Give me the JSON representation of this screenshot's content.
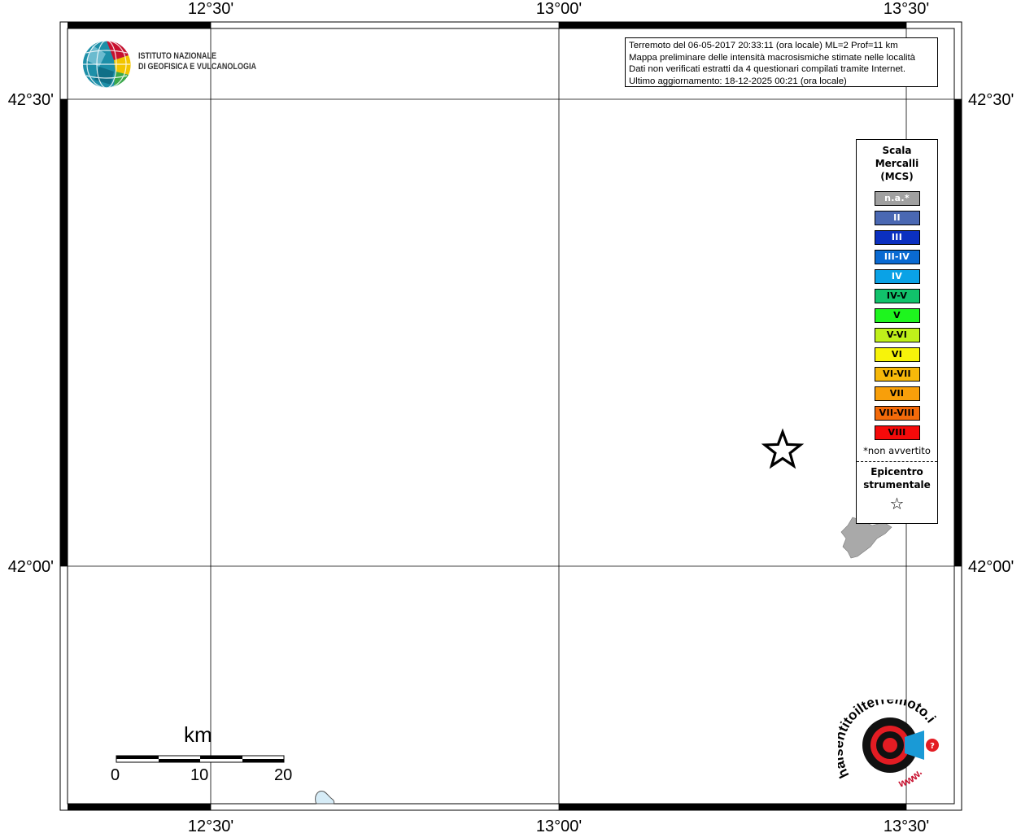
{
  "map": {
    "top_ticks": [
      "12°30'",
      "13°00'",
      "13°30'"
    ],
    "bottom_ticks": [
      "12°30'",
      "13°00'",
      "13°30'"
    ],
    "left_ticks": [
      "42°30'",
      "42°00'"
    ],
    "right_ticks": [
      "42°30'",
      "42°00'"
    ]
  },
  "logo": {
    "line1": "ISTITUTO NAZIONALE",
    "line2": "DI GEOFISICA E VULCANOLOGIA"
  },
  "info": {
    "line1": "Terremoto del 06-05-2017 20:33:11 (ora locale) ML=2 Prof=11 km",
    "line2": "Mappa preliminare delle intensità macrosismiche stimate nelle località",
    "line3": "Dati non verificati estratti da 4 questionari compilati tramite Internet.",
    "line4": "Ultimo aggiornamento: 18-12-2025 00:21 (ora locale)"
  },
  "legend": {
    "title1": "Scala",
    "title2": "Mercalli",
    "title3": "(MCS)",
    "items": [
      {
        "label": "n.a.*",
        "color": "#a0a0a0",
        "light": true
      },
      {
        "label": "II",
        "color": "#4a68b3",
        "light": true
      },
      {
        "label": "III",
        "color": "#0b30c0",
        "light": true
      },
      {
        "label": "III-IV",
        "color": "#0a6ad2",
        "light": true
      },
      {
        "label": "IV",
        "color": "#0aa2e6",
        "light": true
      },
      {
        "label": "IV-V",
        "color": "#11c26b",
        "light": false
      },
      {
        "label": "V",
        "color": "#1ef51e",
        "light": false
      },
      {
        "label": "V-VI",
        "color": "#bff01a",
        "light": false
      },
      {
        "label": "VI",
        "color": "#f7f30a",
        "light": false
      },
      {
        "label": "VI-VII",
        "color": "#f6b80a",
        "light": false
      },
      {
        "label": "VII",
        "color": "#f89f0a",
        "light": false
      },
      {
        "label": "VII-VIII",
        "color": "#f36a0a",
        "light": false
      },
      {
        "label": "VIII",
        "color": "#f50a0a",
        "light": false
      }
    ],
    "note": "*non avvertito",
    "epi1": "Epicentro",
    "epi2": "strumentale",
    "epi_symbol": "☆"
  },
  "scalebar": {
    "unit": "km",
    "labels": [
      "0",
      "10",
      "20"
    ]
  },
  "badge": {
    "ring_text": "haisentitoilterremoto.it",
    "www_text": "www."
  }
}
